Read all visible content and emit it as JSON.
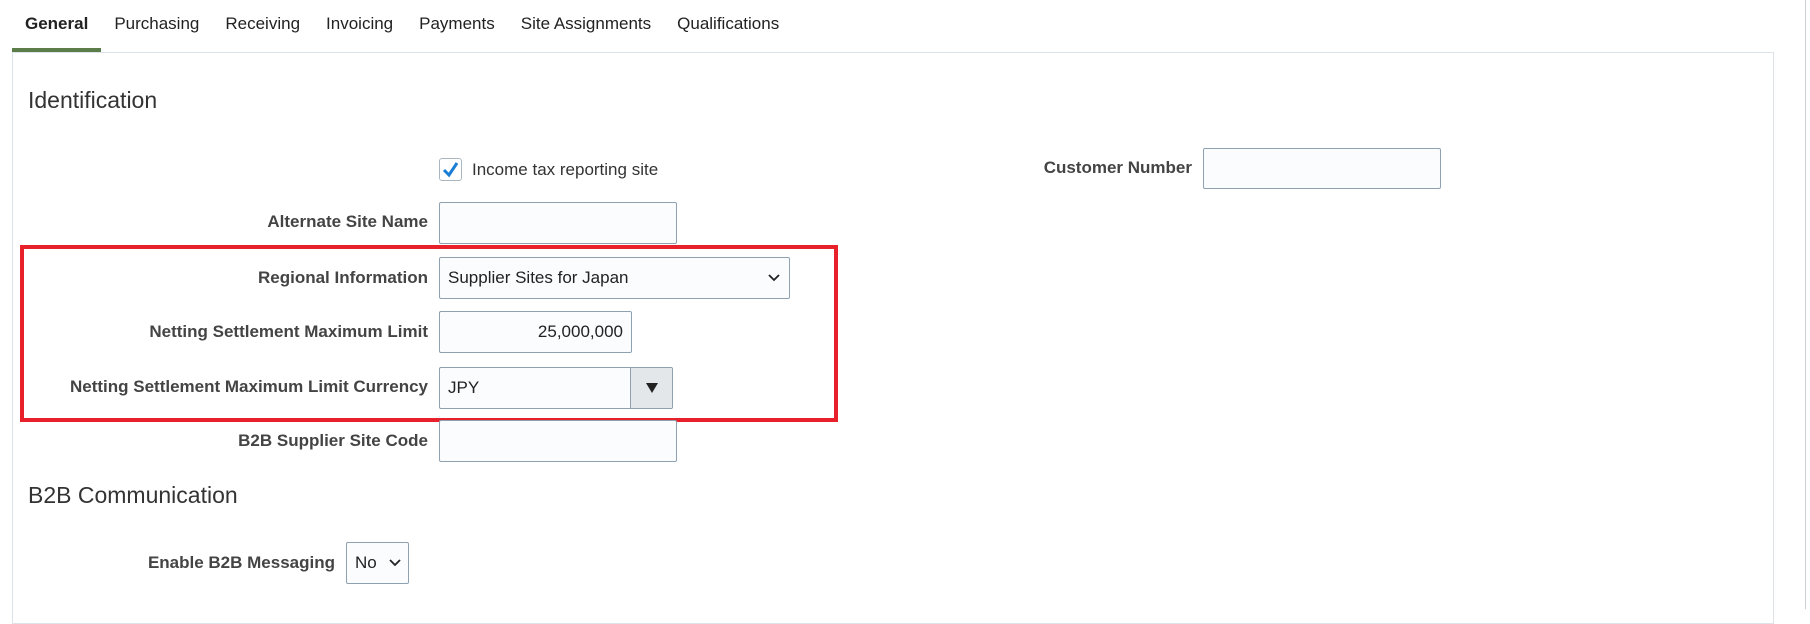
{
  "tabs": [
    "General",
    "Purchasing",
    "Receiving",
    "Invoicing",
    "Payments",
    "Site Assignments",
    "Qualifications"
  ],
  "active_tab": "General",
  "identification": {
    "heading": "Identification",
    "income_tax_checkbox": {
      "label": "Income tax reporting site",
      "checked": true
    },
    "customer_number": {
      "label": "Customer Number",
      "value": ""
    },
    "alternate_site_name": {
      "label": "Alternate Site Name",
      "value": ""
    },
    "regional_information": {
      "label": "Regional Information",
      "value": "Supplier Sites for Japan"
    },
    "netting_limit": {
      "label": "Netting Settlement Maximum Limit",
      "value": "25,000,000"
    },
    "netting_currency": {
      "label": "Netting Settlement Maximum Limit Currency",
      "value": "JPY"
    },
    "b2b_site_code": {
      "label": "B2B Supplier Site Code",
      "value": ""
    }
  },
  "b2b": {
    "heading": "B2B Communication",
    "enable_messaging": {
      "label": "Enable B2B Messaging",
      "value": "No"
    }
  },
  "colors": {
    "highlight": "#e8202a",
    "tab_accent": "#5a7d4a",
    "check": "#1a7fd4"
  }
}
